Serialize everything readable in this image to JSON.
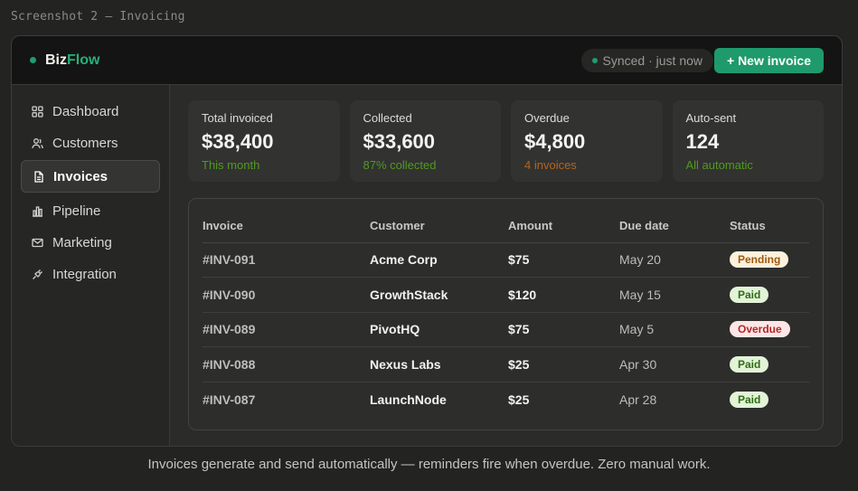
{
  "screenshot_label": "Screenshot 2 — Invoicing",
  "brand": {
    "part1": "Biz",
    "part2": "Flow"
  },
  "sync_status": "Synced · just now",
  "new_invoice_label": "+ New invoice",
  "sidebar": {
    "items": [
      {
        "label": "Dashboard",
        "icon": "grid-icon",
        "active": false
      },
      {
        "label": "Customers",
        "icon": "users-icon",
        "active": false
      },
      {
        "label": "Invoices",
        "icon": "document-icon",
        "active": true
      },
      {
        "label": "Pipeline",
        "icon": "bar-chart-icon",
        "active": false
      },
      {
        "label": "Marketing",
        "icon": "mail-icon",
        "active": false
      },
      {
        "label": "Integration",
        "icon": "plug-icon",
        "active": false
      }
    ]
  },
  "stats": [
    {
      "label": "Total invoiced",
      "value": "$38,400",
      "sub": "This month",
      "sub_color": "green"
    },
    {
      "label": "Collected",
      "value": "$33,600",
      "sub": "87% collected",
      "sub_color": "green"
    },
    {
      "label": "Overdue",
      "value": "$4,800",
      "sub": "4 invoices",
      "sub_color": "orange"
    },
    {
      "label": "Auto-sent",
      "value": "124",
      "sub": "All automatic",
      "sub_color": "green"
    }
  ],
  "table": {
    "headers": [
      "Invoice",
      "Customer",
      "Amount",
      "Due date",
      "Status"
    ],
    "rows": [
      {
        "invoice": "#INV-091",
        "customer": "Acme Corp",
        "amount": "$75",
        "due": "May 20",
        "status": "Pending"
      },
      {
        "invoice": "#INV-090",
        "customer": "GrowthStack",
        "amount": "$120",
        "due": "May 15",
        "status": "Paid"
      },
      {
        "invoice": "#INV-089",
        "customer": "PivotHQ",
        "amount": "$75",
        "due": "May 5",
        "status": "Overdue"
      },
      {
        "invoice": "#INV-088",
        "customer": "Nexus Labs",
        "amount": "$25",
        "due": "Apr 30",
        "status": "Paid"
      },
      {
        "invoice": "#INV-087",
        "customer": "LaunchNode",
        "amount": "$25",
        "due": "Apr 28",
        "status": "Paid"
      }
    ]
  },
  "caption": "Invoices generate and send automatically — reminders fire when overdue. Zero manual work.",
  "colors": {
    "accent": "#1e9a6c",
    "brand_flow": "#26b07c",
    "positive_text": "#4f9a1e",
    "warning_text": "#b2651f"
  }
}
